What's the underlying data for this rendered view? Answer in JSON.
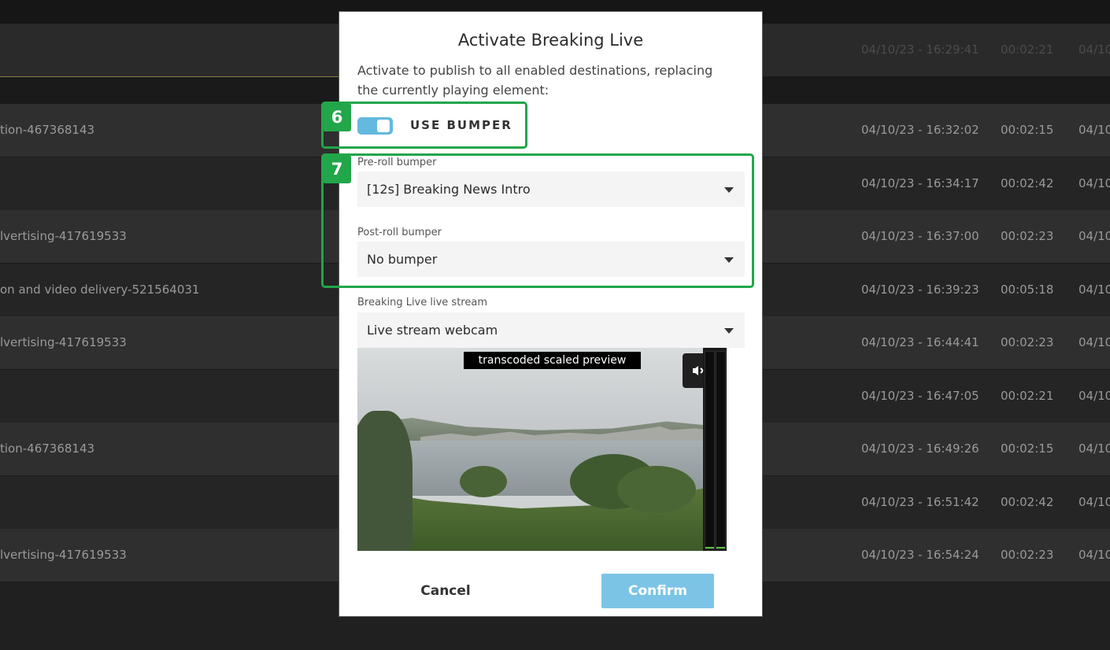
{
  "background_rows": [
    {
      "name": "",
      "date": "04/10/23 - 16:29:41",
      "duration": "00:02:21",
      "tail": "04/10",
      "faded": true
    },
    {
      "name": "tion-467368143",
      "date": "04/10/23 - 16:32:02",
      "duration": "00:02:15",
      "tail": "04/10"
    },
    {
      "name": "",
      "date": "04/10/23 - 16:34:17",
      "duration": "00:02:42",
      "tail": "04/10"
    },
    {
      "name": "lvertising-417619533",
      "date": "04/10/23 - 16:37:00",
      "duration": "00:02:23",
      "tail": "04/10"
    },
    {
      "name": "on and video delivery-521564031",
      "date": "04/10/23 - 16:39:23",
      "duration": "00:05:18",
      "tail": "04/10"
    },
    {
      "name": "lvertising-417619533",
      "date": "04/10/23 - 16:44:41",
      "duration": "00:02:23",
      "tail": "04/10"
    },
    {
      "name": "",
      "date": "04/10/23 - 16:47:05",
      "duration": "00:02:21",
      "tail": "04/10"
    },
    {
      "name": "tion-467368143",
      "date": "04/10/23 - 16:49:26",
      "duration": "00:02:15",
      "tail": "04/10"
    },
    {
      "name": "",
      "date": "04/10/23 - 16:51:42",
      "duration": "00:02:42",
      "tail": "04/10"
    },
    {
      "name": "lvertising-417619533",
      "date": "04/10/23 - 16:54:24",
      "duration": "00:02:23",
      "tail": "04/10"
    }
  ],
  "modal": {
    "title": "Activate Breaking Live",
    "description": "Activate to publish to all enabled destinations, replacing the currently playing element:",
    "use_bumper_label": "USE BUMPER",
    "use_bumper_on": true,
    "pre_roll_label": "Pre-roll bumper",
    "pre_roll_value": "[12s] Breaking News Intro",
    "post_roll_label": "Post-roll bumper",
    "post_roll_value": "No bumper",
    "stream_label": "Breaking Live live stream",
    "stream_value": "Live stream webcam",
    "preview_overlay": "transcoded scaled preview",
    "mute_icon": "speaker-muted-icon",
    "cancel_label": "Cancel",
    "confirm_label": "Confirm"
  },
  "callouts": [
    {
      "number": "6"
    },
    {
      "number": "7"
    }
  ],
  "colors": {
    "accent_blue": "#63b9de",
    "confirm_blue": "#7cc4e6",
    "callout_green": "#22a64a"
  }
}
